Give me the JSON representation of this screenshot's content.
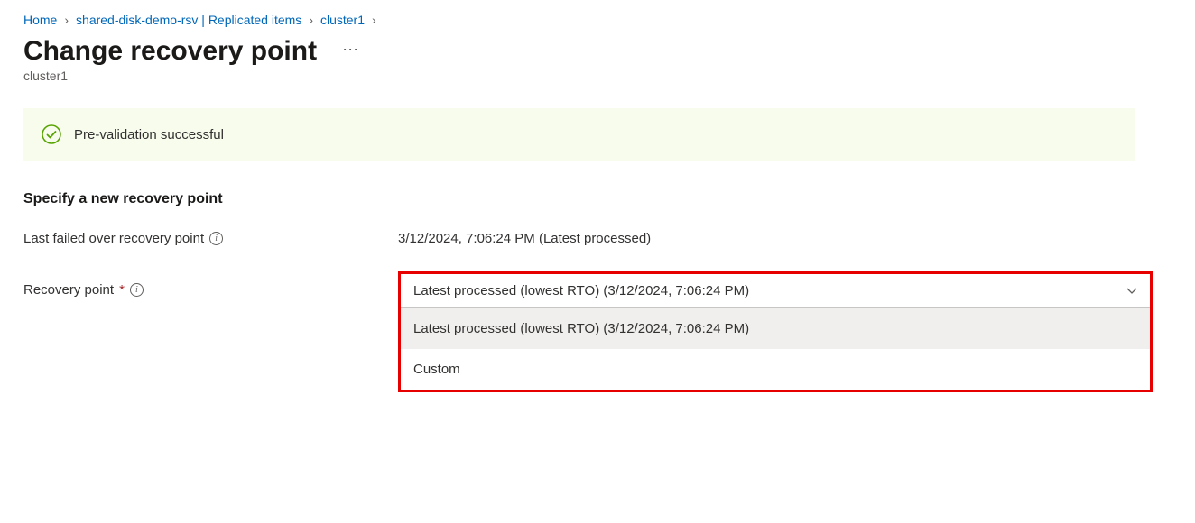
{
  "breadcrumb": {
    "items": [
      {
        "label": "Home"
      },
      {
        "label": "shared-disk-demo-rsv | Replicated items"
      },
      {
        "label": "cluster1"
      }
    ]
  },
  "header": {
    "title": "Change recovery point",
    "subtitle": "cluster1"
  },
  "banner": {
    "message": "Pre-validation successful"
  },
  "section": {
    "heading": "Specify a new recovery point"
  },
  "fields": {
    "last_failed": {
      "label": "Last failed over recovery point",
      "value": "3/12/2024, 7:06:24 PM (Latest processed)"
    },
    "recovery_point": {
      "label": "Recovery point",
      "required": "*",
      "selected": "Latest processed (lowest RTO) (3/12/2024, 7:06:24 PM)",
      "options": [
        "Latest processed (lowest RTO) (3/12/2024, 7:06:24 PM)",
        "Custom"
      ]
    }
  }
}
